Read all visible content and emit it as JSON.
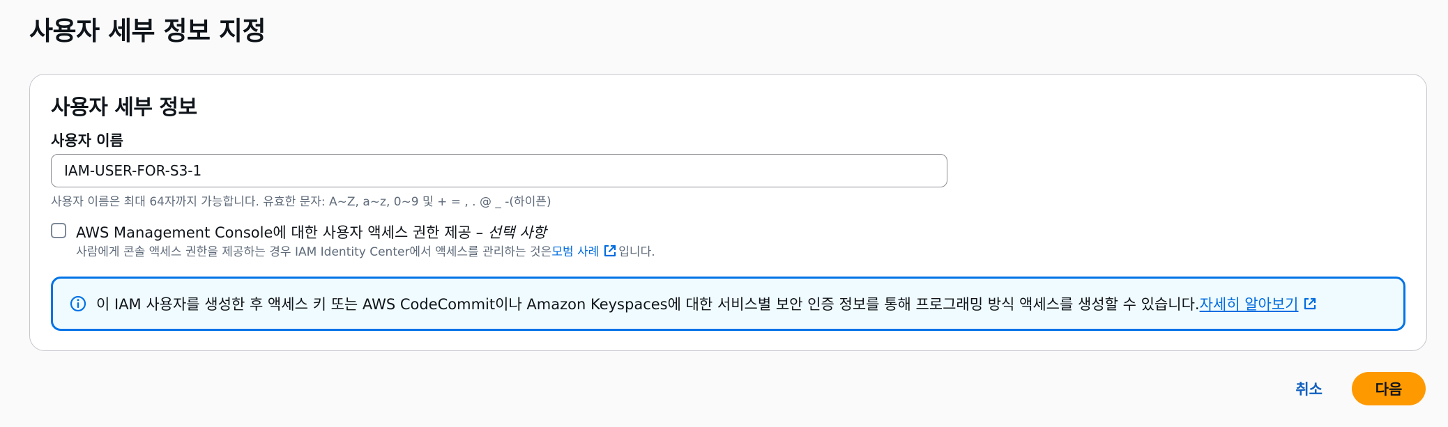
{
  "page": {
    "title": "사용자 세부 정보 지정"
  },
  "user_details": {
    "title": "사용자 세부 정보",
    "username": {
      "label": "사용자 이름",
      "value": "IAM-USER-FOR-S3-1",
      "hint": "사용자 이름은 최대 64자까지 가능합니다. 유효한 문자: A~Z, a~z, 0~9 및 + = , . @ _ -(하이픈)"
    },
    "console_access": {
      "checked": false,
      "label": "AWS Management Console에 대한 사용자 액세스 권한 제공 – ",
      "optional": "선택 사항",
      "desc_before": "사람에게 콘솔 액세스 권한을 제공하는 경우 IAM Identity Center에서 액세스를 관리하는 것은 ",
      "desc_link": "모범 사례",
      "desc_after": "입니다."
    },
    "info": {
      "text": "이 IAM 사용자를 생성한 후 액세스 키 또는 AWS CodeCommit이나 Amazon Keyspaces에 대한 서비스별 보안 인증 정보를 통해 프로그래밍 방식 액세스를 생성할 수 있습니다. ",
      "link": "자세히 알아보기"
    }
  },
  "footer": {
    "cancel_label": "취소",
    "next_label": "다음"
  },
  "colors": {
    "primary_button": "#ff9900",
    "link": "#006ce0",
    "info_border": "#0073e6",
    "info_background": "#f0fbff"
  },
  "icons": {
    "external_link": "external-link-icon",
    "info": "info-icon"
  }
}
